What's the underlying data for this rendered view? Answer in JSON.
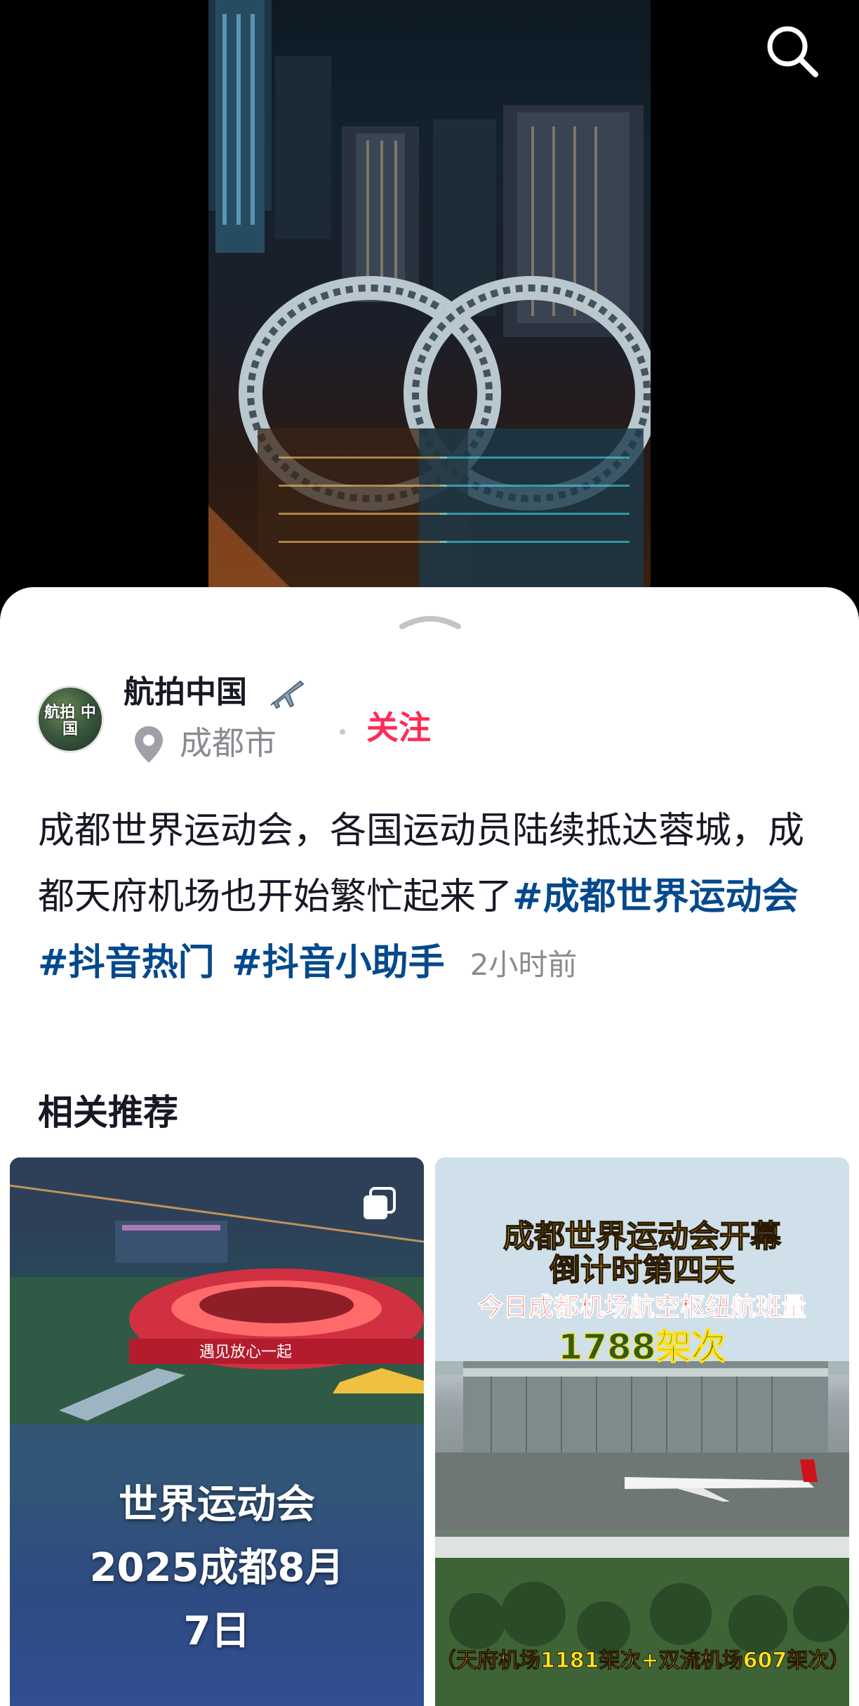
{
  "post": {
    "author_name": "航拍中国",
    "avatar_text": "航拍 中国",
    "location": "成都市",
    "follow_label": "关注",
    "description_text": "成都世界运动会，各国运动员陆续抵达蓉城，成都天府机场也开始繁忙起来了",
    "hashtags": [
      "#成都世界运动会",
      "#抖音热门",
      "#抖音小助手"
    ],
    "time_ago": "2小时前"
  },
  "recommendations": {
    "title": "相关推荐",
    "cards": [
      {
        "caption_lines": [
          "世界运动会",
          "2025成都8月",
          "7日"
        ],
        "banner_text": "遇见放心一起",
        "badge_icon": "multi-image-icon"
      },
      {
        "headline_1": "成都世界运动会开幕",
        "headline_2": "倒计时第四天",
        "subhead": "今日成都机场航空枢纽航班量",
        "count": "1788架次",
        "footer": "（天府机场1181架次+双流机场607架次）"
      }
    ]
  },
  "colors": {
    "accent": "#fe2c55",
    "hashtag": "#04498d",
    "text": "#161823",
    "muted": "#8a8b91"
  },
  "icons": {
    "search": "search-icon",
    "location": "location-pin-icon",
    "plane": "airplane-icon",
    "handle": "chevron-up-icon"
  }
}
